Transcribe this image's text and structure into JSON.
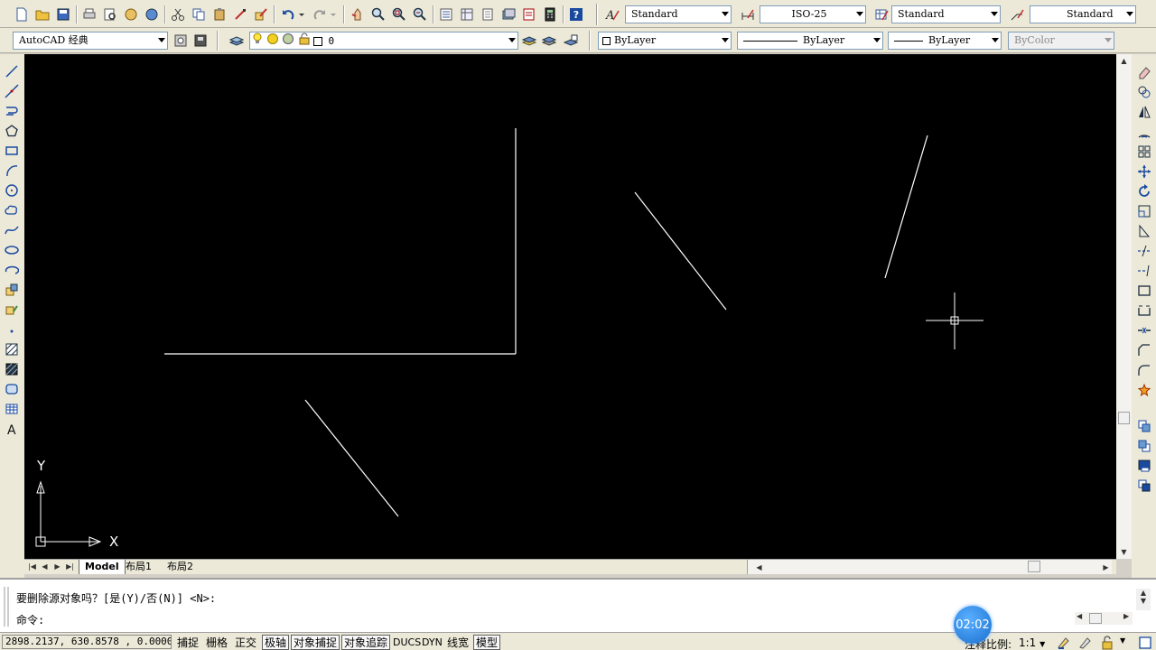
{
  "toolbar1": {
    "text_style": "Standard",
    "dim_style": "ISO-25",
    "table_style": "Standard",
    "mleader_style": "Standard"
  },
  "toolbar2": {
    "workspace": "AutoCAD 经典",
    "layer": "0",
    "color": "ByLayer",
    "linetype": "ByLayer",
    "lineweight": "ByLayer",
    "plotstyle": "ByColor"
  },
  "canvas": {
    "ucs_x_label": "X",
    "ucs_y_label": "Y",
    "background": "#000000",
    "line_color": "#ffffff"
  },
  "tabs": {
    "model": "Model",
    "layout1": "布局1",
    "layout2": "布局2"
  },
  "command": {
    "prompt_line": "要删除源对象吗？[是(Y)/否(N)] <N>:",
    "input_line": "命令:"
  },
  "status": {
    "coords": "2898.2137, 630.8578 , 0.0000",
    "snap": "捕捉",
    "grid": "栅格",
    "ortho": "正交",
    "polar": "极轴",
    "osnap": "对象捕捉",
    "otrack": "对象追踪",
    "ducs": "DUCS",
    "dyn": "DYN",
    "lwt": "线宽",
    "model": "模型",
    "annotation_scale_label": "注释比例:",
    "annotation_scale": "1:1"
  },
  "timer": "02:02"
}
